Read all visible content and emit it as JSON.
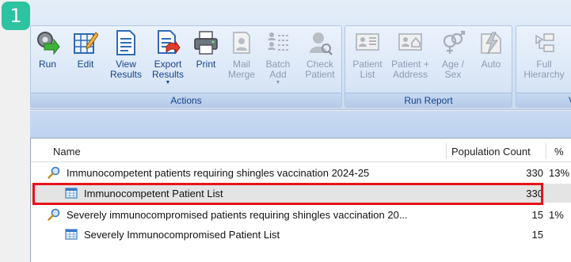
{
  "step_badge": "1",
  "ribbon": {
    "actions_group": {
      "label": "Actions",
      "buttons": [
        {
          "label": "Run",
          "icon": "run-gear-icon"
        },
        {
          "label": "Edit",
          "icon": "edit-grid-icon"
        },
        {
          "label": "View\nResults",
          "icon": "view-results-icon"
        },
        {
          "label": "Export\nResults",
          "icon": "export-results-icon"
        },
        {
          "label": "Print",
          "icon": "printer-icon"
        },
        {
          "label": "Mail\nMerge",
          "icon": "mail-merge-icon"
        },
        {
          "label": "Batch\nAdd",
          "icon": "batch-add-icon"
        },
        {
          "label": "Check\nPatient",
          "icon": "check-patient-icon"
        }
      ]
    },
    "run_report_group": {
      "label": "Run Report",
      "buttons": [
        {
          "label": "Patient\nList",
          "icon": "patient-list-icon"
        },
        {
          "label": "Patient +\nAddress",
          "icon": "patient-address-icon"
        },
        {
          "label": "Age /\nSex",
          "icon": "age-sex-icon"
        },
        {
          "label": "Auto",
          "icon": "auto-report-icon"
        }
      ]
    },
    "view_group": {
      "label": "Vie",
      "buttons": [
        {
          "label": "Full\nHierarchy",
          "icon": "full-hierarchy-icon"
        }
      ]
    }
  },
  "grid": {
    "columns": {
      "name": "Name",
      "population_count": "Population Count",
      "percent": "%"
    },
    "rows": [
      {
        "name": "Immunocompetent patients requiring shingles vaccination 2024-25",
        "count": "330",
        "pct": "13%",
        "type": "search"
      },
      {
        "name": "Immunocompetent Patient List",
        "count": "330",
        "pct": "",
        "type": "list"
      },
      {
        "name": "Severely immunocompromised patients requiring shingles vaccination 20...",
        "count": "15",
        "pct": "1%",
        "type": "search"
      },
      {
        "name": "Severely Immunocompromised Patient List",
        "count": "15",
        "pct": "",
        "type": "list"
      }
    ]
  },
  "colors": {
    "badge": "#2cc3a0",
    "highlight": "#e8131b",
    "ribbon_text": "#15428b"
  }
}
